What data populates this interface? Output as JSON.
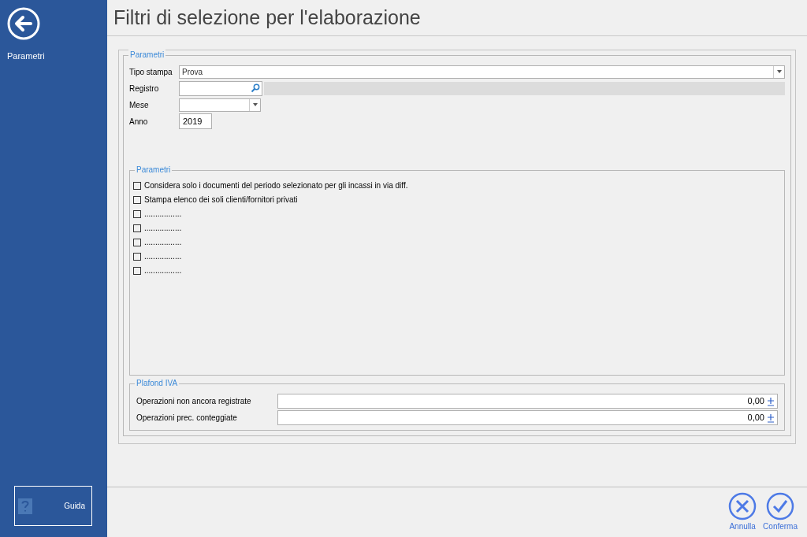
{
  "sidebar": {
    "section": "Parametri",
    "help_button": "Guida"
  },
  "title": "Filtri di selezione per l'elaborazione",
  "main_group": {
    "legend": "Parametri",
    "fields": [
      {
        "kind": "dropdown",
        "label": "Tipo stampa",
        "value": "Prova"
      },
      {
        "kind": "lookup",
        "label": "Registro"
      },
      {
        "kind": "combo",
        "label": "Mese"
      },
      {
        "kind": "text",
        "label": "Anno",
        "value": "2019"
      }
    ]
  },
  "options_group": {
    "legend": "Parametri",
    "options": [
      {
        "label": "Considera solo i documenti del periodo selezionato per gli incassi in via diff.",
        "checked": false
      },
      {
        "label": "Stampa elenco dei soli clienti/fornitori privati",
        "checked": false
      },
      {
        "label": ".................",
        "checked": false
      },
      {
        "label": ".................",
        "checked": false
      },
      {
        "label": ".................",
        "checked": false
      },
      {
        "label": ".................",
        "checked": false
      },
      {
        "label": ".................",
        "checked": false
      }
    ]
  },
  "plafond_group": {
    "legend": "Plafond IVA",
    "fields": [
      {
        "label": "Operazioni non ancora registrate",
        "value": "0,00"
      },
      {
        "label": "Operazioni prec. conteggiate",
        "value": "0,00"
      }
    ]
  },
  "footer_buttons": [
    {
      "kind": "cancel",
      "label": "Annulla"
    },
    {
      "kind": "confirm",
      "label": "Conferma"
    }
  ]
}
